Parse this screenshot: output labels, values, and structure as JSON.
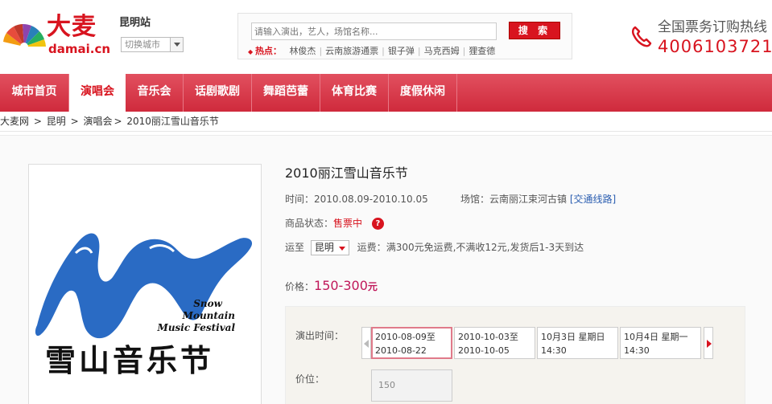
{
  "brand": {
    "name_cn": "大麦",
    "name_en": "damai.cn",
    "colors": {
      "primary": "#d8141f",
      "nav": "#d8404f",
      "price": "#c0185a",
      "link": "#2a5db0"
    }
  },
  "city": {
    "name": "昆明站",
    "switch_label": "切换城市"
  },
  "search": {
    "placeholder": "请输入演出，艺人，场馆名称...",
    "button_label": "搜 索",
    "hot_label": "热点：",
    "hot_links": [
      "林俊杰",
      "云南旅游通票",
      "银子弹",
      "马克西姆",
      "狸查德"
    ]
  },
  "hotline": {
    "label": "全国票务订购热线",
    "number": "4006103721"
  },
  "nav": {
    "items": [
      {
        "label": "城市首页",
        "active": false
      },
      {
        "label": "演唱会",
        "active": true
      },
      {
        "label": "音乐会",
        "active": false
      },
      {
        "label": "话剧歌剧",
        "active": false
      },
      {
        "label": "舞蹈芭蕾",
        "active": false
      },
      {
        "label": "体育比赛",
        "active": false
      },
      {
        "label": "度假休闲",
        "active": false
      }
    ]
  },
  "breadcrumb": {
    "items": [
      "大麦网",
      "昆明",
      "演唱会",
      "2010丽江雪山音乐节"
    ],
    "separator": ">"
  },
  "poster": {
    "title_cn": "雪山音乐节",
    "title_en_1": "Snow",
    "title_en_2": "Mountain",
    "title_en_3": "Music Festival"
  },
  "event": {
    "title": "2010丽江雪山音乐节",
    "time_label": "时间：",
    "time_value": "2010.08.09-2010.10.05",
    "venue_label": "场馆：",
    "venue_value": "云南丽江束河古镇",
    "venue_link": "[交通线路]",
    "status_label": "商品状态：",
    "status_value": "售票中",
    "help_icon": "?",
    "ship_label": "运至",
    "ship_city": "昆明",
    "ship_fee_label": "运费：",
    "ship_fee_value": "满300元免运费,不满收12元,发货后1-3天到达",
    "price_label": "价格：",
    "price_value": "150-300",
    "price_unit": "元"
  },
  "selection": {
    "time_label": "演出时间：",
    "price_label": "价位：",
    "dates": [
      {
        "line1": "2010-08-09至",
        "line2": "2010-08-22",
        "selected": true
      },
      {
        "line1": "2010-10-03至",
        "line2": "2010-10-05",
        "selected": false
      },
      {
        "line1": "10月3日  星期日",
        "line2": "14:30",
        "selected": false
      },
      {
        "line1": "10月4日  星期一",
        "line2": "14:30",
        "selected": false
      }
    ],
    "prices": [
      "150"
    ]
  }
}
